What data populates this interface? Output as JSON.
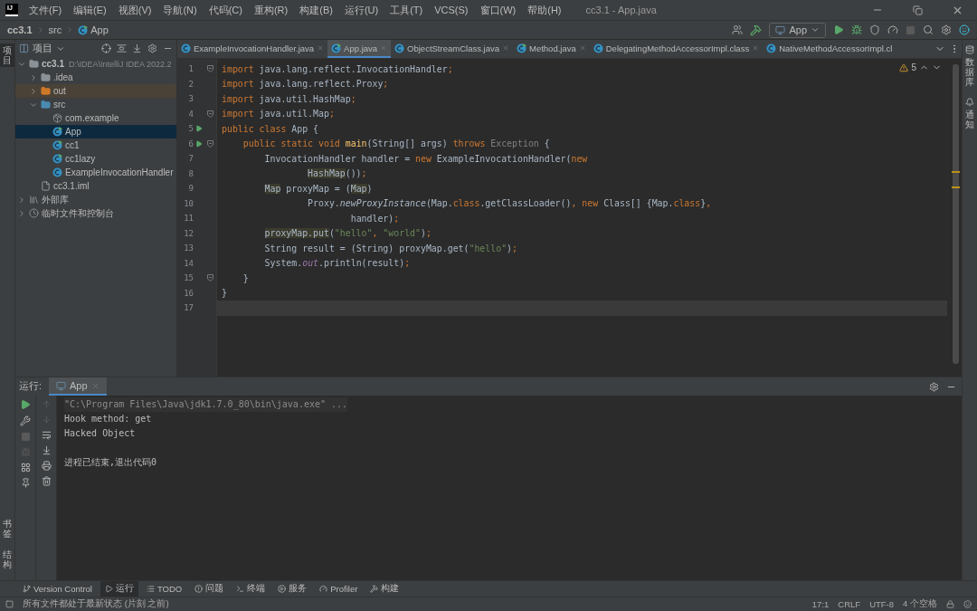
{
  "window": {
    "logo": "IJ",
    "title": "cc3.1 - App.java"
  },
  "menu": [
    "文件(F)",
    "编辑(E)",
    "视图(V)",
    "导航(N)",
    "代码(C)",
    "重构(R)",
    "构建(B)",
    "运行(U)",
    "工具(T)",
    "VCS(S)",
    "窗口(W)",
    "帮助(H)"
  ],
  "breadcrumb": [
    {
      "label": "cc3.1",
      "kind": "module"
    },
    {
      "label": "src",
      "kind": "folder"
    },
    {
      "label": "App",
      "kind": "class"
    }
  ],
  "run_config": "App",
  "left_strip": {
    "top": [
      {
        "label": "项目",
        "selected": true
      }
    ],
    "bottom": [
      {
        "label": "书签",
        "selected": false
      },
      {
        "label": "结构",
        "selected": false
      }
    ]
  },
  "right_strip": [
    {
      "label": "数据库",
      "kind": "database"
    },
    {
      "label": "通知",
      "kind": "notifications"
    }
  ],
  "project_panel": {
    "title": "项目",
    "tree": [
      {
        "label": "cc3.1",
        "detail": "D:\\IDEA\\IntelliJ IDEA 2022.2",
        "kind": "module",
        "expanded": true,
        "selected": false,
        "children": [
          {
            "label": ".idea",
            "kind": "folder",
            "expanded": false,
            "selected": false
          },
          {
            "label": "out",
            "kind": "excluded",
            "expanded": false,
            "selected": false
          },
          {
            "label": "src",
            "kind": "source",
            "expanded": true,
            "selected": false,
            "children": [
              {
                "label": "com.example",
                "kind": "package",
                "selected": false
              },
              {
                "label": "App",
                "kind": "main",
                "selected": true
              },
              {
                "label": "cc1",
                "kind": "main",
                "selected": false
              },
              {
                "label": "cc1lazy",
                "kind": "main",
                "selected": false
              },
              {
                "label": "ExampleInvocationHandler",
                "kind": "class",
                "selected": false
              }
            ]
          },
          {
            "label": "cc3.1.iml",
            "kind": "file",
            "selected": false
          }
        ]
      },
      {
        "label": "外部库",
        "kind": "library",
        "expanded": false,
        "selected": false
      },
      {
        "label": "临时文件和控制台",
        "kind": "scratch",
        "expanded": false,
        "selected": false
      }
    ]
  },
  "editor_tabs": [
    {
      "label": "ExampleInvocationHandler.java",
      "kind": "class",
      "selected": false
    },
    {
      "label": "App.java",
      "kind": "main",
      "selected": true
    },
    {
      "label": "ObjectStreamClass.java",
      "kind": "class",
      "selected": false
    },
    {
      "label": "Method.java",
      "kind": "main",
      "selected": false
    },
    {
      "label": "DelegatingMethodAccessorImpl.class",
      "kind": "class",
      "selected": false
    },
    {
      "label": "NativeMethodAccessorImpl.cl",
      "kind": "class",
      "selected": false
    }
  ],
  "warnings": "5",
  "code": [
    {
      "number": "1",
      "run": false,
      "fold": true,
      "current": false,
      "tokens": [
        {
          "kind": "kw",
          "text": "import"
        },
        {
          "kind": "plain",
          "text": " java.lang.reflect.InvocationHandler"
        },
        {
          "kind": "kw",
          "text": ";"
        }
      ]
    },
    {
      "number": "2",
      "run": false,
      "fold": false,
      "current": false,
      "tokens": [
        {
          "kind": "kw",
          "text": "import"
        },
        {
          "kind": "plain",
          "text": " java.lang.reflect.Proxy"
        },
        {
          "kind": "kw",
          "text": ";"
        }
      ]
    },
    {
      "number": "3",
      "run": false,
      "fold": false,
      "current": false,
      "tokens": [
        {
          "kind": "kw",
          "text": "import"
        },
        {
          "kind": "plain",
          "text": " java.util.HashMap"
        },
        {
          "kind": "kw",
          "text": ";"
        }
      ]
    },
    {
      "number": "4",
      "run": false,
      "fold": true,
      "current": false,
      "tokens": [
        {
          "kind": "kw",
          "text": "import"
        },
        {
          "kind": "plain",
          "text": " java.util.Map"
        },
        {
          "kind": "kw",
          "text": ";"
        }
      ]
    },
    {
      "number": "5",
      "run": true,
      "fold": false,
      "current": false,
      "tokens": [
        {
          "kind": "kw",
          "text": "public class "
        },
        {
          "kind": "plain",
          "text": "App {"
        }
      ]
    },
    {
      "number": "6",
      "run": true,
      "fold": true,
      "current": false,
      "tokens": [
        {
          "kind": "kw",
          "text": "    public static void "
        },
        {
          "kind": "decl",
          "text": "main"
        },
        {
          "kind": "plain",
          "text": "(String[] args) "
        },
        {
          "kind": "kw",
          "text": "throws "
        },
        {
          "kind": "muted",
          "text": "Exception"
        },
        {
          "kind": "plain",
          "text": " {"
        }
      ]
    },
    {
      "number": "7",
      "run": false,
      "fold": false,
      "current": false,
      "tokens": [
        {
          "kind": "plain",
          "text": "        InvocationHandler handler = "
        },
        {
          "kind": "kw",
          "text": "new "
        },
        {
          "kind": "plain",
          "text": "ExampleInvocationHandler("
        },
        {
          "kind": "kw",
          "text": "new"
        }
      ]
    },
    {
      "number": "8",
      "run": false,
      "fold": false,
      "current": false,
      "tokens": [
        {
          "kind": "wrapmark",
          "text": "HashMap"
        },
        {
          "kind": "plain",
          "text": "())"
        },
        {
          "kind": "kw",
          "text": ";"
        }
      ]
    },
    {
      "number": "9",
      "run": false,
      "fold": false,
      "current": false,
      "tokens": [
        {
          "kind": "bodymark",
          "text": "Map"
        },
        {
          "kind": "plain",
          "text": " proxyMap = ("
        },
        {
          "kind": "mark",
          "text": "Map"
        },
        {
          "kind": "plain",
          "text": ")"
        }
      ]
    },
    {
      "number": "10",
      "run": false,
      "fold": false,
      "current": false,
      "tokens": [
        {
          "kind": "plain",
          "text": "                Proxy."
        },
        {
          "kind": "call",
          "text": "newProxyInstance"
        },
        {
          "kind": "plain",
          "text": "(Map."
        },
        {
          "kind": "kw",
          "text": "class"
        },
        {
          "kind": "plain",
          "text": ".getClassLoader()"
        },
        {
          "kind": "kw",
          "text": ", new "
        },
        {
          "kind": "plain",
          "text": "Class[] {Map."
        },
        {
          "kind": "kw",
          "text": "class"
        },
        {
          "kind": "plain",
          "text": "}"
        },
        {
          "kind": "kw",
          "text": ","
        }
      ]
    },
    {
      "number": "11",
      "run": false,
      "fold": false,
      "current": false,
      "tokens": [
        {
          "kind": "plain",
          "text": "                        handler)"
        },
        {
          "kind": "kw",
          "text": ";"
        }
      ]
    },
    {
      "number": "12",
      "run": false,
      "fold": false,
      "current": false,
      "tokens": [
        {
          "kind": "bodymark",
          "text": "proxyMap.put"
        },
        {
          "kind": "plain",
          "text": "("
        },
        {
          "kind": "str",
          "text": "\"hello\""
        },
        {
          "kind": "kw",
          "text": ", "
        },
        {
          "kind": "str",
          "text": "\"world\""
        },
        {
          "kind": "plain",
          "text": ")"
        },
        {
          "kind": "kw",
          "text": ";"
        }
      ]
    },
    {
      "number": "13",
      "run": false,
      "fold": false,
      "current": false,
      "tokens": [
        {
          "kind": "plain",
          "text": "        String result = (String) proxyMap.get("
        },
        {
          "kind": "str",
          "text": "\"hello\""
        },
        {
          "kind": "plain",
          "text": ")"
        },
        {
          "kind": "kw",
          "text": ";"
        }
      ]
    },
    {
      "number": "14",
      "run": false,
      "fold": false,
      "current": false,
      "tokens": [
        {
          "kind": "plain",
          "text": "        System."
        },
        {
          "kind": "field",
          "text": "out"
        },
        {
          "kind": "plain",
          "text": ".println(result)"
        },
        {
          "kind": "kw",
          "text": ";"
        }
      ]
    },
    {
      "number": "15",
      "run": false,
      "fold": true,
      "current": false,
      "tokens": [
        {
          "kind": "plain",
          "text": "    }"
        }
      ]
    },
    {
      "number": "16",
      "run": false,
      "fold": false,
      "current": false,
      "tokens": [
        {
          "kind": "plain",
          "text": "}"
        }
      ]
    },
    {
      "number": "17",
      "run": false,
      "fold": false,
      "current": true
    }
  ],
  "run_panel": {
    "label": "运行:",
    "tabs": [
      {
        "label": "App",
        "selected": true
      }
    ],
    "console": [
      {
        "kind": "command",
        "text": "\"C:\\Program Files\\Java\\jdk1.7.0_80\\bin\\java.exe\" ..."
      },
      {
        "kind": "output",
        "text": "Hook method: get"
      },
      {
        "kind": "output",
        "text": "Hacked Object"
      },
      {
        "kind": "exit",
        "text": "进程已结束,退出代码0"
      }
    ]
  },
  "tool_tabs": [
    {
      "label": "Version Control",
      "kind": "vcs",
      "selected": false
    },
    {
      "label": "运行",
      "kind": "run",
      "selected": true
    },
    {
      "label": "TODO",
      "kind": "todo",
      "selected": false
    },
    {
      "label": "问题",
      "kind": "problems",
      "selected": false
    },
    {
      "label": "终端",
      "kind": "terminal",
      "selected": false
    },
    {
      "label": "服务",
      "kind": "services",
      "selected": false
    },
    {
      "label": "Profiler",
      "kind": "profiler",
      "selected": false
    },
    {
      "label": "构建",
      "kind": "build",
      "selected": false
    }
  ],
  "status_bar": {
    "message": "所有文件都处于最新状态 (片刻 之前)",
    "items": [
      "17:1",
      "CRLF",
      "UTF-8",
      "4 个空格"
    ]
  }
}
